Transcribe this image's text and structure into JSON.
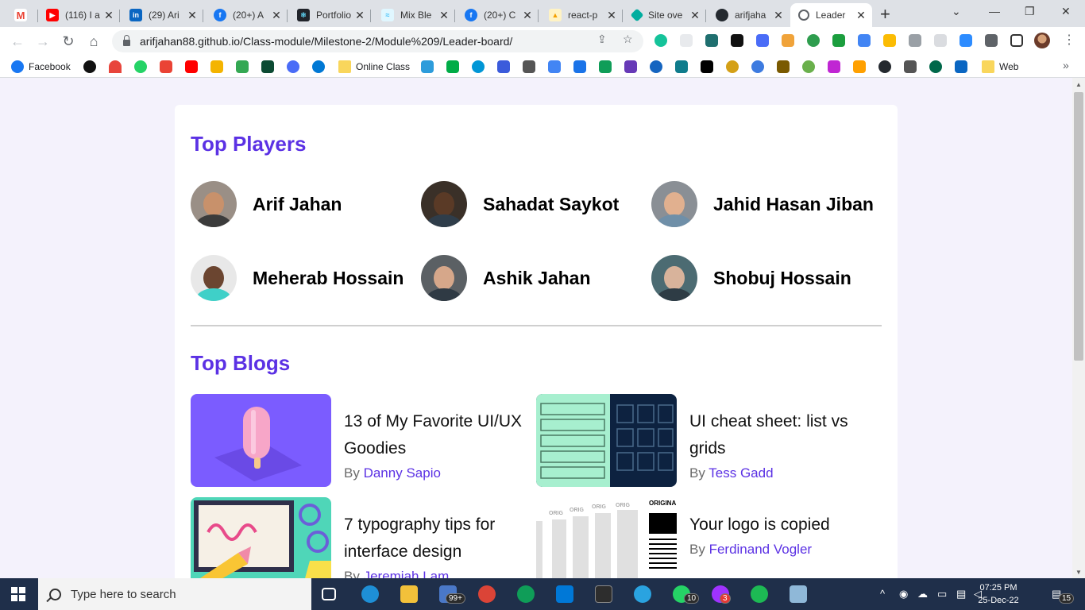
{
  "browser": {
    "tabs": [
      {
        "title": "",
        "favicon": "gmail-icon",
        "color": "#ea4335"
      },
      {
        "title": "(116) I a",
        "favicon": "youtube-icon",
        "color": "#ff0000"
      },
      {
        "title": "(29) Ari",
        "favicon": "linkedin-icon",
        "color": "#0a66c2"
      },
      {
        "title": "(20+) A",
        "favicon": "facebook-icon",
        "color": "#1877f2"
      },
      {
        "title": "Portfolio",
        "favicon": "react-icon",
        "color": "#20232a"
      },
      {
        "title": "Mix Ble",
        "favicon": "tailwind-icon",
        "color": "#38bdf8"
      },
      {
        "title": "(20+) C",
        "favicon": "facebook-icon",
        "color": "#1877f2"
      },
      {
        "title": "react-p",
        "favicon": "firebase-icon",
        "color": "#ffca28"
      },
      {
        "title": "Site ove",
        "favicon": "netlify-icon",
        "color": "#00ad9f"
      },
      {
        "title": "arifjaha",
        "favicon": "github-icon",
        "color": "#24292f"
      },
      {
        "title": "Leader",
        "favicon": "globe-icon",
        "color": "#5f6368"
      }
    ],
    "url": "arifjahan88.github.io/Class-module/Milestone-2/Module%209/Leader-board/"
  },
  "bookmarks": {
    "items": [
      {
        "label": "Facebook",
        "color": "#1877f2"
      },
      {
        "label": "Online Class",
        "color": "#f9d65c"
      },
      {
        "label": "Web",
        "color": "#f9d65c"
      }
    ]
  },
  "page": {
    "top_players_title": "Top Players",
    "players": [
      {
        "name": "Arif Jahan",
        "skin": "#c8916b",
        "shirt": "#3b3b3b",
        "bg": "#9a8f86"
      },
      {
        "name": "Sahadat Saykot",
        "skin": "#5a3a26",
        "shirt": "#2f3d4a",
        "bg": "#3a3028"
      },
      {
        "name": "Jahid Hasan Jiban",
        "skin": "#e1b08f",
        "shirt": "#6f8fa8",
        "bg": "#8a8f95"
      },
      {
        "name": "Meherab Hossain",
        "skin": "#6b4530",
        "shirt": "#3fd0c8",
        "bg": "#e8e8e8"
      },
      {
        "name": "Ashik Jahan",
        "skin": "#d6a78a",
        "shirt": "#2f3a44",
        "bg": "#5b6064"
      },
      {
        "name": "Shobuj Hossain",
        "skin": "#d8b39b",
        "shirt": "#2e3c45",
        "bg": "#4c6b72"
      }
    ],
    "top_blogs_title": "Top Blogs",
    "blogs": [
      {
        "title": "13 of My Favorite UI/UX Goodies",
        "by": "By",
        "author": "Danny Sapio"
      },
      {
        "title": "UI cheat sheet: list vs grids",
        "by": "By",
        "author": "Tess Gadd"
      },
      {
        "title": "7 typography tips for interface design",
        "by": "By",
        "author": "Jeremiah Lam"
      },
      {
        "title": "Your logo is copied",
        "by": "By",
        "author": "Ferdinand Vogler"
      }
    ],
    "thumb_text": {
      "orig": "ORIG",
      "original": "ORIGINA"
    }
  },
  "taskbar": {
    "search_placeholder": "Type here to search",
    "badge_mail": "99+",
    "badge_whatsapp": "10",
    "badge_messenger": "3",
    "time": "07:25 PM",
    "date": "25-Dec-22",
    "notifications": "15"
  }
}
